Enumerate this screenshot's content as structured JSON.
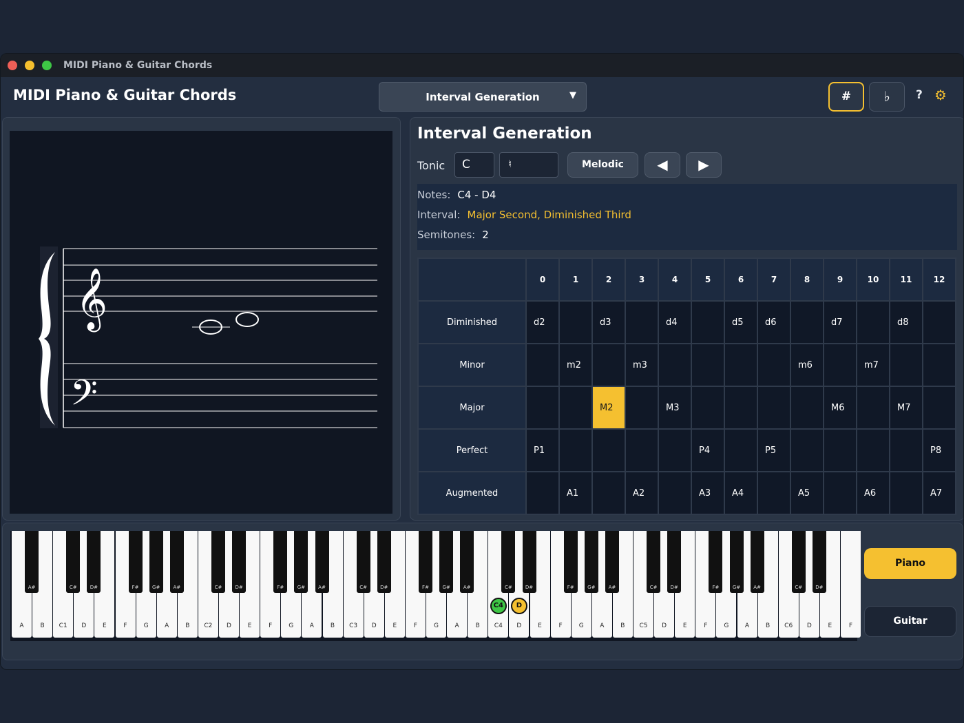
{
  "window": {
    "title": "MIDI Piano & Guitar Chords"
  },
  "header": {
    "app_title": "MIDI Piano & Guitar Chords",
    "mode": "Interval Generation",
    "sharp_label": "#",
    "flat_label": "♭",
    "help_label": "?"
  },
  "interval": {
    "title": "Interval Generation",
    "tonic_label": "Tonic",
    "tonic_value": "C",
    "accidental_value": "♮",
    "melodic_label": "Melodic",
    "notes_label": "Notes:",
    "notes_value": "C4 - D4",
    "interval_label": "Interval:",
    "interval_value": "Major Second, Diminished Third",
    "semitones_label": "Semitones:",
    "semitones_value": "2"
  },
  "grid": {
    "columns": [
      "0",
      "1",
      "2",
      "3",
      "4",
      "5",
      "6",
      "7",
      "8",
      "9",
      "10",
      "11",
      "12"
    ],
    "rows": [
      {
        "name": "Diminished",
        "cells": [
          "d2",
          "",
          "d3",
          "",
          "d4",
          "",
          "d5",
          "d6",
          "",
          "d7",
          "",
          "d8",
          ""
        ]
      },
      {
        "name": "Minor",
        "cells": [
          "",
          "m2",
          "",
          "m3",
          "",
          "",
          "",
          "",
          "m6",
          "",
          "m7",
          "",
          ""
        ]
      },
      {
        "name": "Major",
        "cells": [
          "",
          "",
          "M2",
          "",
          "M3",
          "",
          "",
          "",
          "",
          "M6",
          "",
          "M7",
          ""
        ]
      },
      {
        "name": "Perfect",
        "cells": [
          "P1",
          "",
          "",
          "",
          "",
          "P4",
          "",
          "P5",
          "",
          "",
          "",
          "",
          "P8"
        ]
      },
      {
        "name": "Augmented",
        "cells": [
          "",
          "A1",
          "",
          "A2",
          "",
          "A3",
          "A4",
          "",
          "A5",
          "",
          "A6",
          "",
          "A7"
        ]
      }
    ],
    "highlight": {
      "row": 2,
      "col": 2
    }
  },
  "piano": {
    "white_keys": [
      "A",
      "B",
      "C1",
      "D",
      "E",
      "F",
      "G",
      "A",
      "B",
      "C2",
      "D",
      "E",
      "F",
      "G",
      "A",
      "B",
      "C3",
      "D",
      "E",
      "F",
      "G",
      "A",
      "B",
      "C4",
      "D",
      "E",
      "F",
      "G",
      "A",
      "B",
      "C5",
      "D",
      "E",
      "F",
      "G",
      "A",
      "B",
      "C6",
      "D",
      "E",
      "F"
    ],
    "black_keys": [
      {
        "label": "A#",
        "after": 0
      },
      {
        "label": "C#",
        "after": 2
      },
      {
        "label": "D#",
        "after": 3
      },
      {
        "label": "F#",
        "after": 5
      },
      {
        "label": "G#",
        "after": 6
      },
      {
        "label": "A#",
        "after": 7
      },
      {
        "label": "C#",
        "after": 9
      },
      {
        "label": "D#",
        "after": 10
      },
      {
        "label": "F#",
        "after": 12
      },
      {
        "label": "G#",
        "after": 13
      },
      {
        "label": "A#",
        "after": 14
      },
      {
        "label": "C#",
        "after": 16
      },
      {
        "label": "D#",
        "after": 17
      },
      {
        "label": "F#",
        "after": 19
      },
      {
        "label": "G#",
        "after": 20
      },
      {
        "label": "A#",
        "after": 21
      },
      {
        "label": "C#",
        "after": 23
      },
      {
        "label": "D#",
        "after": 24
      },
      {
        "label": "F#",
        "after": 26
      },
      {
        "label": "G#",
        "after": 27
      },
      {
        "label": "A#",
        "after": 28
      },
      {
        "label": "C#",
        "after": 30
      },
      {
        "label": "D#",
        "after": 31
      },
      {
        "label": "F#",
        "after": 33
      },
      {
        "label": "G#",
        "after": 34
      },
      {
        "label": "A#",
        "after": 35
      },
      {
        "label": "C#",
        "after": 37
      },
      {
        "label": "D#",
        "after": 38
      }
    ],
    "markers": [
      {
        "label": "C4",
        "key": 23,
        "color": "#3ec645"
      },
      {
        "label": "D",
        "key": 24,
        "color": "#f5c030"
      }
    ],
    "piano_label": "Piano",
    "guitar_label": "Guitar"
  },
  "colors": {
    "accent": "#f5c030",
    "active_note": "#3ec645"
  }
}
